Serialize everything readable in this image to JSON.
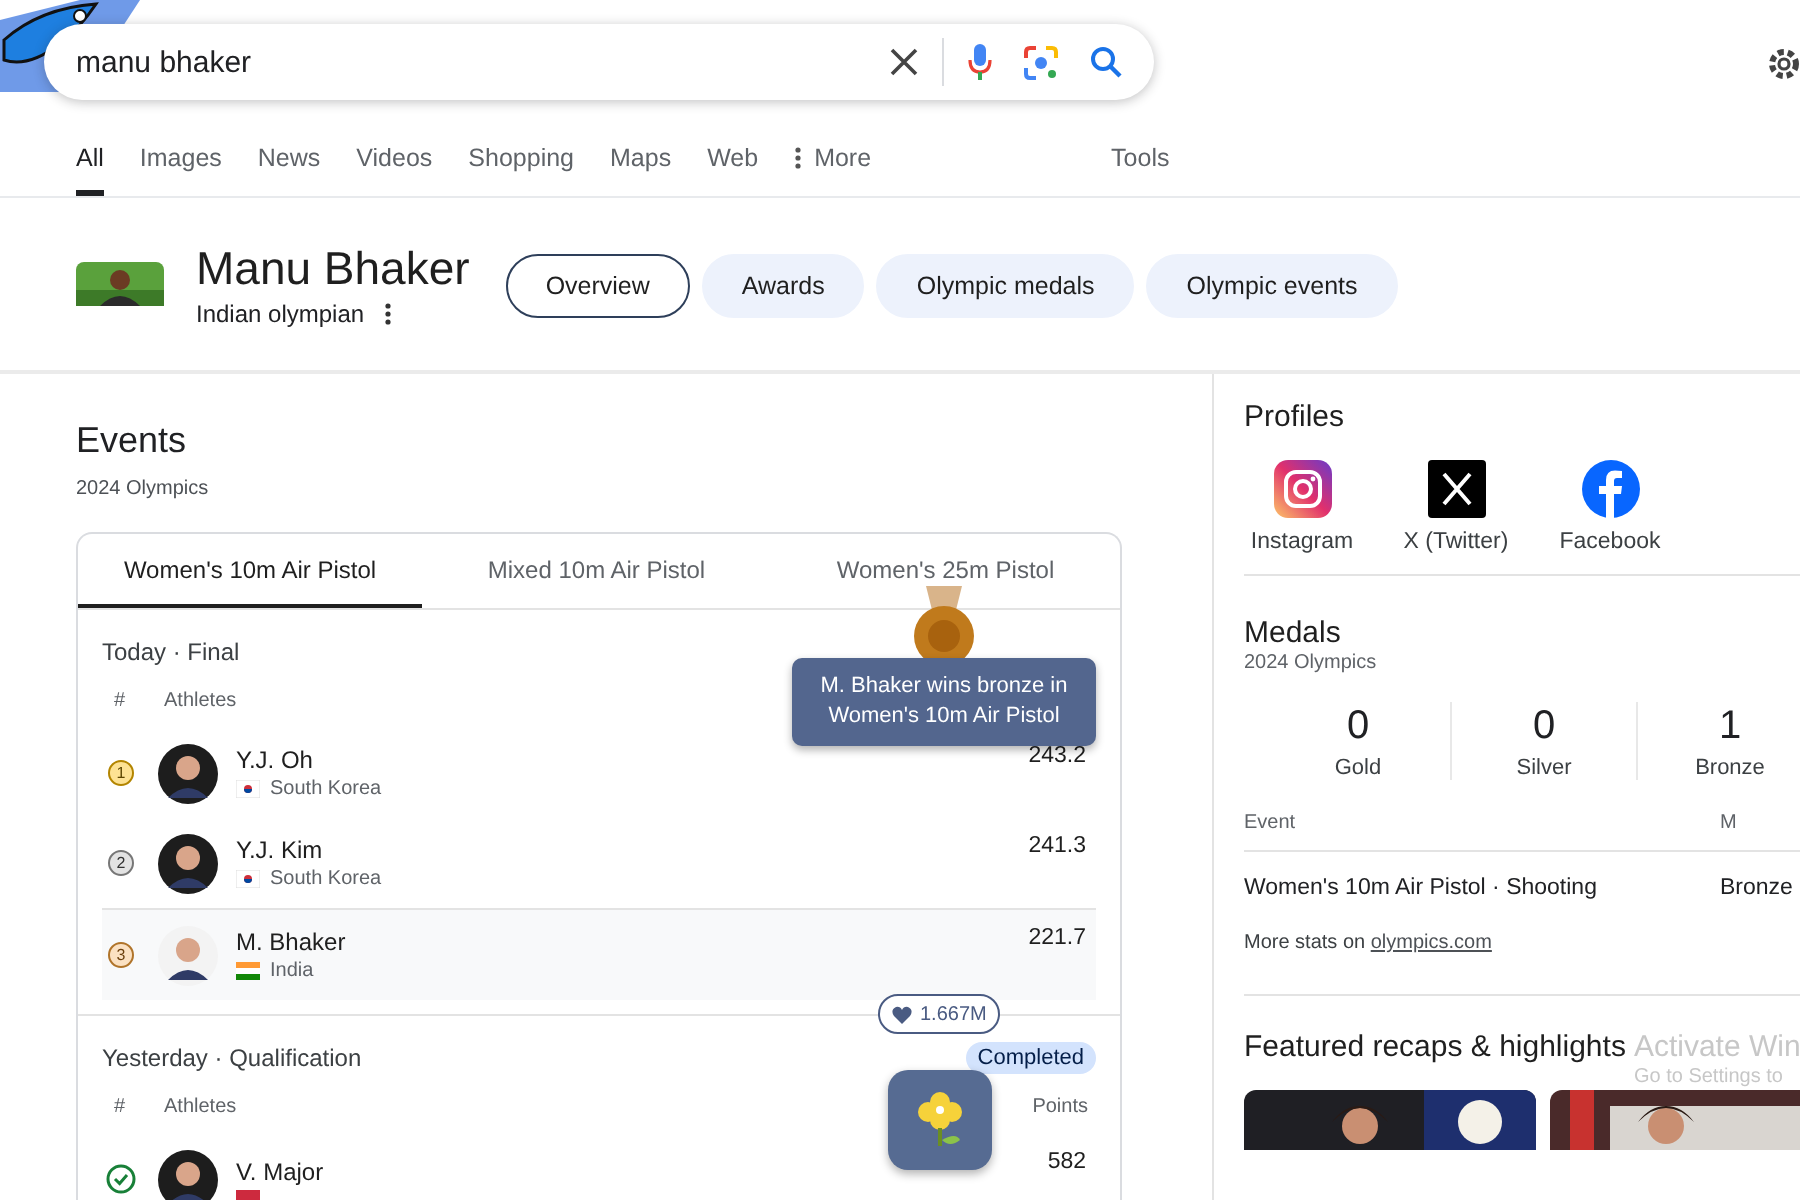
{
  "search": {
    "query": "manu bhaker"
  },
  "nav_tabs": [
    {
      "label": "All",
      "selected": true,
      "kind": "plain"
    },
    {
      "label": "Images",
      "selected": false,
      "kind": "plain"
    },
    {
      "label": "News",
      "selected": false,
      "kind": "plain"
    },
    {
      "label": "Videos",
      "selected": false,
      "kind": "plain"
    },
    {
      "label": "Shopping",
      "selected": false,
      "kind": "plain"
    },
    {
      "label": "Maps",
      "selected": false,
      "kind": "plain"
    },
    {
      "label": "Web",
      "selected": false,
      "kind": "plain"
    },
    {
      "label": "More",
      "selected": false,
      "kind": "menu"
    }
  ],
  "tools": "Tools",
  "entity": {
    "name": "Manu Bhaker",
    "subtitle": "Indian olympian",
    "chips": [
      {
        "label": "Overview",
        "selected": true
      },
      {
        "label": "Awards",
        "selected": false
      },
      {
        "label": "Olympic medals",
        "selected": false
      },
      {
        "label": "Olympic events",
        "selected": false
      }
    ]
  },
  "events": {
    "title": "Events",
    "subtitle": "2024 Olympics",
    "tabs": [
      {
        "label": "Women's 10m Air Pistol",
        "selected": true
      },
      {
        "label": "Mixed 10m Air Pistol",
        "selected": false
      },
      {
        "label": "Women's 25m Pistol",
        "selected": false
      }
    ],
    "sections": [
      {
        "heading": "Today · Final",
        "columns": [
          "#",
          "Athletes"
        ],
        "rows": [
          {
            "rank": "1",
            "kind": "gold",
            "name": "Y.J. Oh",
            "country": "South Korea",
            "flag": {
              "kind": "kr"
            },
            "score": "243.2",
            "selected": false
          },
          {
            "rank": "2",
            "kind": "silver",
            "name": "Y.J. Kim",
            "country": "South Korea",
            "flag": {
              "kind": "kr"
            },
            "score": "241.3",
            "selected": false
          },
          {
            "rank": "3",
            "kind": "bronze",
            "name": "M. Bhaker",
            "country": "India",
            "flag": {
              "kind": "in"
            },
            "score": "221.7",
            "selected": true
          }
        ]
      },
      {
        "heading": "Yesterday · Qualification",
        "status": "Completed",
        "columns": [
          "#",
          "Athletes",
          "Points"
        ],
        "rows": [
          {
            "kind": "qualified",
            "name": "V. Major",
            "flag": {
              "kind": "hu"
            },
            "score": "582",
            "selected": false
          }
        ]
      }
    ]
  },
  "tooltip": "M. Bhaker wins bronze in Women's 10m Air Pistol",
  "likes": {
    "count": "1.667M"
  },
  "profiles": {
    "title": "Profiles",
    "items": [
      {
        "label": "Instagram",
        "kind": "instagram"
      },
      {
        "label": "X (Twitter)",
        "kind": "x"
      },
      {
        "label": "Facebook",
        "kind": "facebook"
      }
    ]
  },
  "medals": {
    "title": "Medals",
    "subtitle": "2024 Olympics",
    "counts": [
      {
        "count": "0",
        "label": "Gold"
      },
      {
        "count": "0",
        "label": "Silver"
      },
      {
        "count": "1",
        "label": "Bronze"
      }
    ],
    "columns": [
      "Event",
      "M"
    ],
    "rows": [
      {
        "event": "Women's 10m Air Pistol · Shooting",
        "medal": "Bronze"
      }
    ],
    "more": {
      "text": "More stats on ",
      "link": "olympics.com"
    }
  },
  "featured": {
    "title": "Featured recaps & highlights"
  },
  "os_overlay": {
    "line_1": "Activate Win",
    "line_2": "Go to Settings to"
  }
}
